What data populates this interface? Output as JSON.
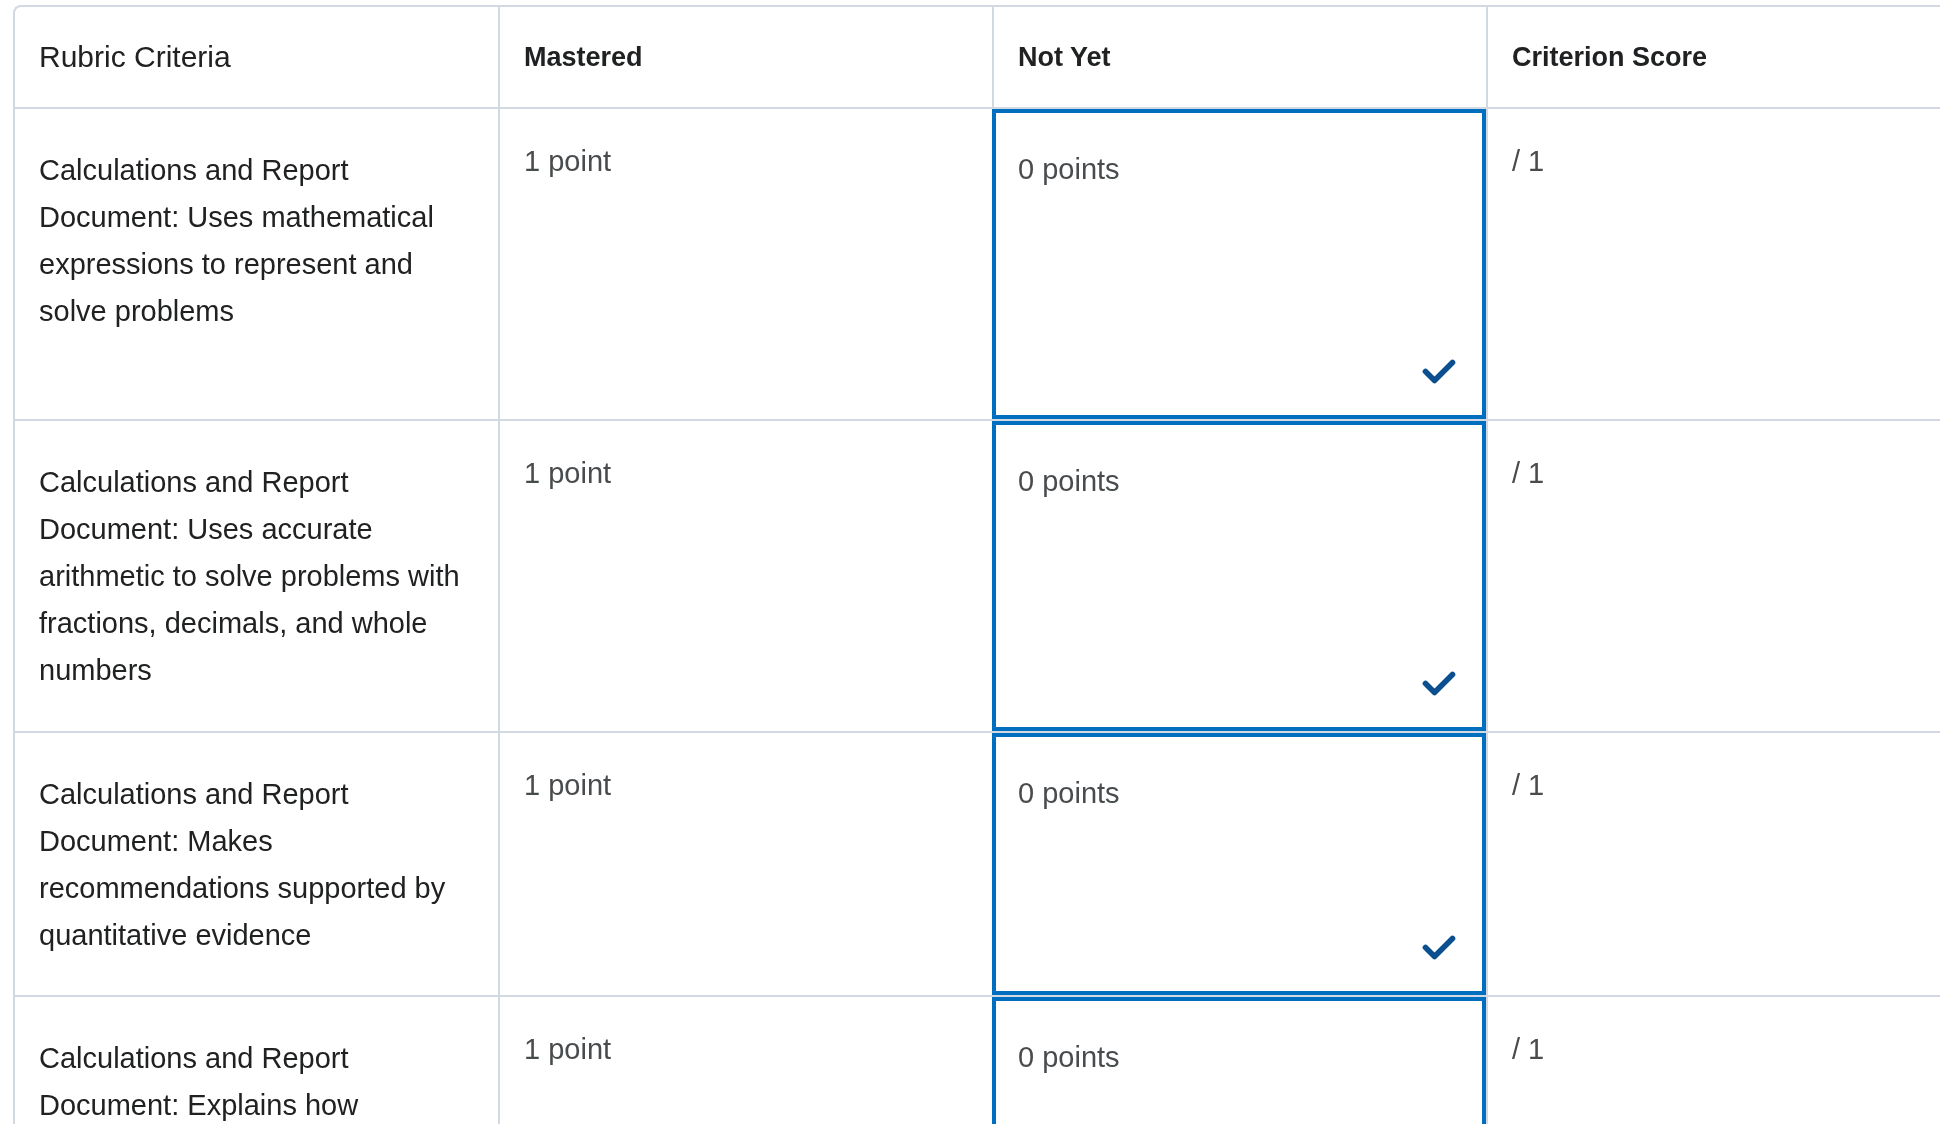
{
  "table": {
    "columns": [
      "Rubric Criteria",
      "Mastered",
      "Not Yet",
      "Criterion Score"
    ],
    "rows": [
      {
        "criterion": "Calculations and Report Document: Uses mathematical expressions to represent and solve problems",
        "levels": [
          {
            "points": "1 point",
            "selected": false
          },
          {
            "points": "0 points",
            "selected": true
          }
        ],
        "score": "/ 1"
      },
      {
        "criterion": "Calculations and Report Document: Uses accurate arithmetic to solve problems with fractions, decimals, and whole numbers",
        "levels": [
          {
            "points": "1 point",
            "selected": false
          },
          {
            "points": "0 points",
            "selected": true
          }
        ],
        "score": "/ 1"
      },
      {
        "criterion": "Calculations and Report Document: Makes recommendations supported by quantitative evidence",
        "levels": [
          {
            "points": "1 point",
            "selected": false
          },
          {
            "points": "0 points",
            "selected": true
          }
        ],
        "score": "/ 1"
      },
      {
        "criterion": "Calculations and Report Document: Explains how",
        "levels": [
          {
            "points": "1 point",
            "selected": false
          },
          {
            "points": "0 points",
            "selected": true
          }
        ],
        "score": "/ 1"
      }
    ]
  }
}
